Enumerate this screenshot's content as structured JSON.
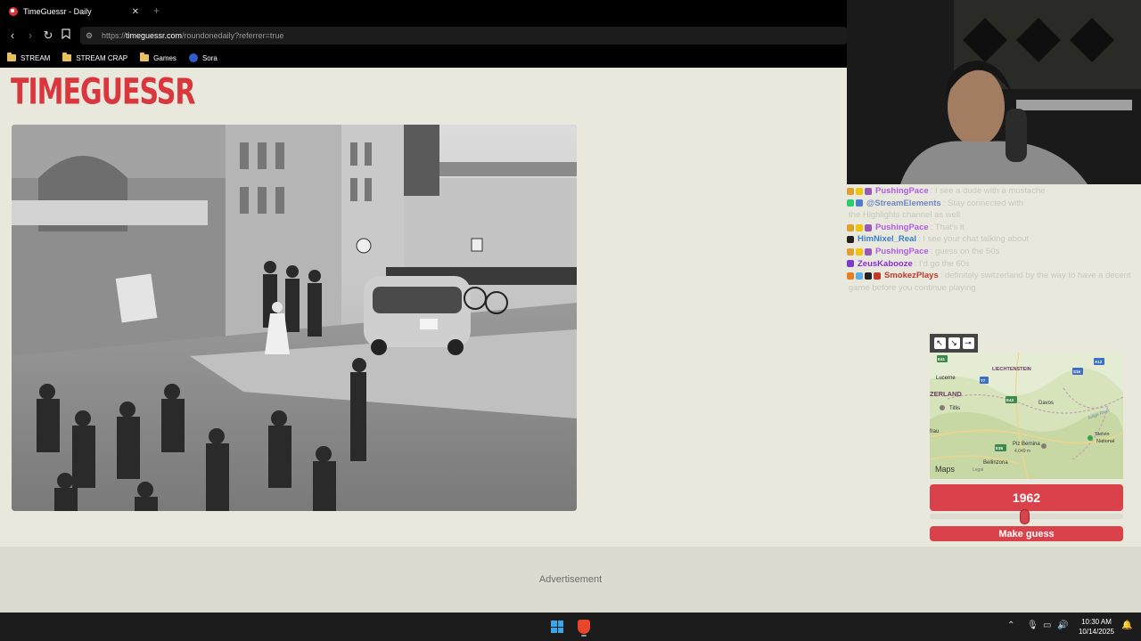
{
  "browser": {
    "tab_title": "TimeGuessr - Daily",
    "tab_close": "✕",
    "new_tab": "+",
    "url_prefix": "https://",
    "url_host": "timeguessr.com",
    "url_path": "/roundonedaily?referrer=true",
    "bookmarks": [
      "STREAM",
      "STREAM CRAP",
      "Games",
      "Sora"
    ]
  },
  "page": {
    "logo": "TIMEGUESSR",
    "advertisement": "Advertisement"
  },
  "chat": [
    {
      "name": "PushingPace",
      "color": "#b05de8",
      "badges": [
        "#e0a030",
        "#f1c40f",
        "#9b59b6"
      ],
      "msg": ": I see a dude with a mustache"
    },
    {
      "name": "@StreamElements",
      "color": "#6f87c7",
      "badges": [
        "#2ecc71",
        "#4a7ec9"
      ],
      "msg": ": Stay connected with"
    },
    {
      "name": "",
      "color": "#c9c8bd",
      "badges": [],
      "msg": "the Highlights channel as well"
    },
    {
      "name": "PushingPace",
      "color": "#b05de8",
      "badges": [
        "#e0a030",
        "#f1c40f",
        "#9b59b6"
      ],
      "msg": ": That's it"
    },
    {
      "name": "HimNixel_Real",
      "color": "#3a7fd0",
      "badges": [
        "#222222"
      ],
      "msg": ": I see your chat talking about"
    },
    {
      "name": "PushingPace",
      "color": "#b05de8",
      "badges": [
        "#e0a030",
        "#f1c40f",
        "#9b59b6"
      ],
      "msg": ": guess on the 50s"
    },
    {
      "name": "ZeusKabooze",
      "color": "#8a2be2",
      "badges": [
        "#7d3cc8"
      ],
      "msg": ": I'd go the 60s"
    },
    {
      "name": "SmokezPlays",
      "color": "#c0392b",
      "badges": [
        "#e67e22",
        "#5dade2",
        "#222222",
        "#c0392b"
      ],
      "msg": ": definitely switzerland by the way to have a decent"
    },
    {
      "name": "",
      "color": "#c9c8bd",
      "badges": [],
      "msg": "game before you continue playing"
    }
  ],
  "map": {
    "labels": {
      "liechtenstein": "LIECHTENSTEIN",
      "lucerne": "Lucerne",
      "switzerland": "ZERLAND",
      "titlis": "Titlis",
      "davos": "Davos",
      "frau": "frau",
      "piz_bernina": "Piz Bernina",
      "bernina_elev": "4.049 m",
      "bellinzona": "Bellinzona",
      "legal": "Legal",
      "stelvio": "Stelvio",
      "national": "National",
      "adige": "Adige River",
      "apple_maps": "Maps"
    },
    "shields": {
      "e41": "E41",
      "a12": "A12",
      "s16": "S16",
      "t7": "T7",
      "e43": "E43",
      "e35": "E35"
    },
    "control_icons": [
      "expand-arrow-icon",
      "shrink-arrow-icon",
      "pin-icon"
    ]
  },
  "guess": {
    "year": "1962",
    "slider_fraction": 0.49,
    "button": "Make guess"
  },
  "taskbar": {
    "time": "10:30 AM",
    "date": "10/14/2025"
  }
}
